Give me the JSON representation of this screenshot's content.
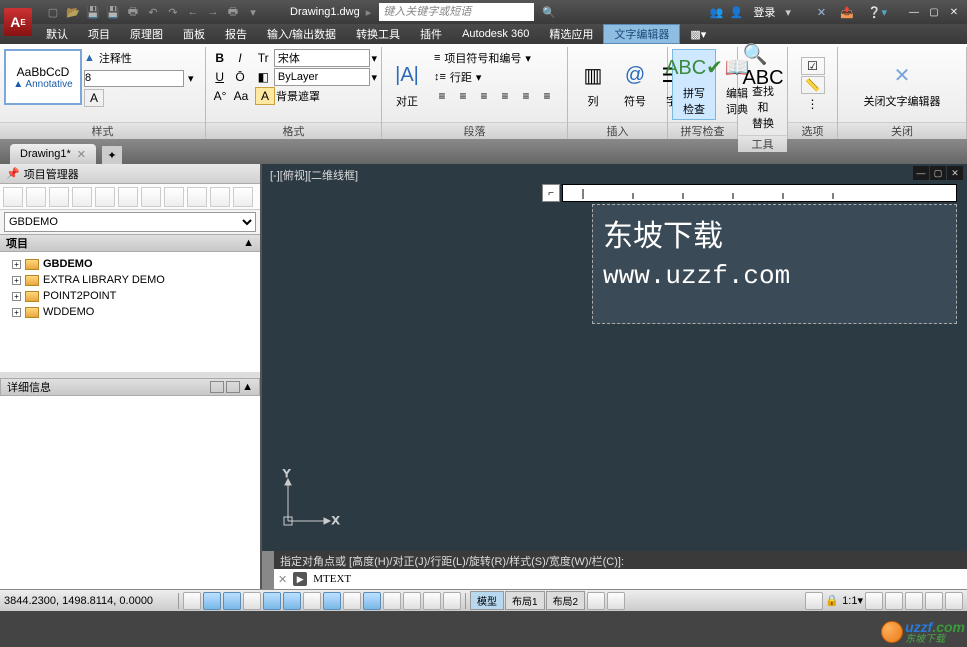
{
  "title": "Drawing1.dwg",
  "search_placeholder": "键入关键字或短语",
  "login": "登录",
  "menus": [
    "默认",
    "项目",
    "原理图",
    "面板",
    "报告",
    "输入/输出数据",
    "转换工具",
    "插件",
    "Autodesk 360",
    "精选应用",
    "文字编辑器"
  ],
  "style": {
    "preview_text": "AaBbCcD",
    "annot_text": "Annotative",
    "annot_btn": "注释性",
    "font_size": "8"
  },
  "format": {
    "font": "宋体",
    "layer": "ByLayer",
    "mask": "背景遮罩"
  },
  "para": {
    "align": "对正",
    "bullets": "项目符号和编号",
    "spacing": "行距"
  },
  "insert": {
    "col": "列",
    "symbol": "符号",
    "field": "字段"
  },
  "spell": {
    "check": "拼写\n检查",
    "dict": "编辑\n词典",
    "group": "拼写检查"
  },
  "find": {
    "find": "查找和\n替换",
    "group": "工具"
  },
  "options_group": "选项",
  "close": {
    "btn": "关闭文字编辑器",
    "group": "关闭"
  },
  "groups": {
    "style": "样式",
    "format": "格式",
    "para": "段落",
    "insert": "插入"
  },
  "doc_tab": "Drawing1*",
  "pm": {
    "title": "项目管理器",
    "combo": "GBDEMO",
    "section": "项目",
    "items": [
      "GBDEMO",
      "EXTRA LIBRARY DEMO",
      "POINT2POINT",
      "WDDEMO"
    ],
    "details": "详细信息"
  },
  "canvas": {
    "view_label": "[-][俯视][二维线框]",
    "text1": "东坡下载",
    "text2": "www.uzzf.com",
    "axis_x": "X",
    "axis_y": "Y"
  },
  "cmd": {
    "prompt": "指定对角点或 [高度(H)/对正(J)/行距(L)/旋转(R)/样式(S)/宽度(W)/栏(C)]:",
    "input": "MTEXT"
  },
  "status": {
    "coords": "3844.2300, 1498.8114, 0.0000",
    "model": "模型",
    "layout1": "布局1",
    "layout2": "布局2",
    "scale": "1:1"
  },
  "watermark": {
    "name": "uzzf",
    "sub": "东坡下载",
    ".com": ".com"
  }
}
